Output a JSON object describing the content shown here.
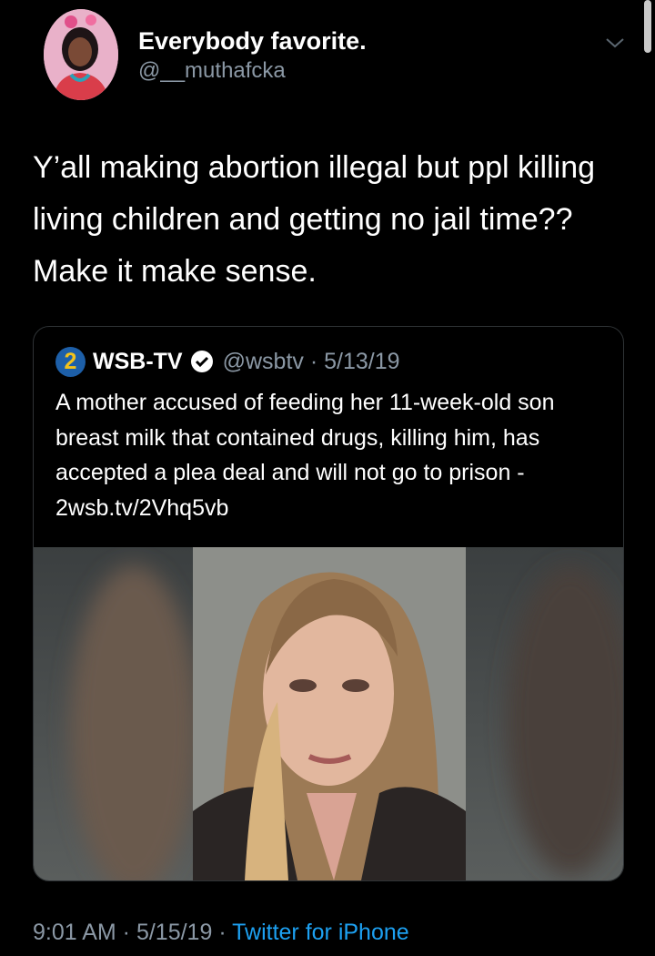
{
  "tweet": {
    "author_name": "Everybody favorite.",
    "author_handle": "@__muthafcka",
    "text": "Y’all making abortion illegal but ppl killing living children and getting no jail time?? Make it make sense.",
    "time": "9:01 AM",
    "date": "5/15/19",
    "source": "Twitter for iPhone"
  },
  "quoted_tweet": {
    "logo_text": "2",
    "author_name": "WSB-TV",
    "author_handle": "@wsbtv",
    "date": "5/13/19",
    "text": "A mother accused of feeding her 11-week-old son breast milk that contained drugs, killing him, has accepted a plea deal and will not go to prison - 2wsb.tv/2Vhq5vb",
    "verified": true
  },
  "icons": {
    "more": "chevron-down-icon",
    "verified": "verified-badge-icon"
  },
  "colors": {
    "background": "#000000",
    "secondary_text": "#8b98a5",
    "link": "#1da1f2",
    "card_border": "#2f3336",
    "wsb_logo_bg": "#1d5fa8",
    "wsb_logo_fg": "#f3c21a"
  }
}
